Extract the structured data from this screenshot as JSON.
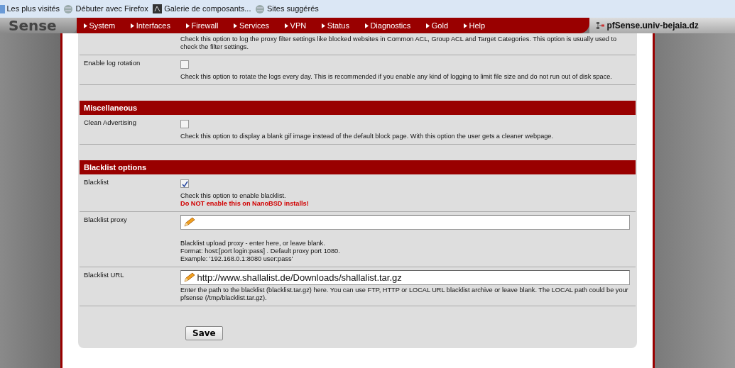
{
  "bookmarks": [
    {
      "label": "Les plus visités",
      "kind": "page"
    },
    {
      "label": "Débuter avec Firefox",
      "kind": "globe"
    },
    {
      "label": "Galerie de composants...",
      "kind": "gallery"
    },
    {
      "label": "Sites suggérés",
      "kind": "globe"
    }
  ],
  "logo": "Sense",
  "menu": [
    "System",
    "Interfaces",
    "Firewall",
    "Services",
    "VPN",
    "Status",
    "Diagnostics",
    "Gold",
    "Help"
  ],
  "hostname": "pfSense.univ-bejaia.dz",
  "sections": [
    {
      "rows": [
        {
          "kind": "note",
          "description": "Check this option to log the proxy filter settings like blocked websites in Common ACL, Group ACL and Target Categories. This option is usually used to check the filter settings."
        },
        {
          "kind": "checkbox",
          "label": "Enable log rotation",
          "checked": false,
          "description": "Check this option to rotate the logs every day. This is recommended if you enable any kind of logging to limit file size and do not run out of disk space."
        }
      ]
    },
    {
      "title": "Miscellaneous",
      "rows": [
        {
          "kind": "checkbox",
          "label": "Clean Advertising",
          "checked": false,
          "description": "Check this option to display a blank gif image instead of the default block page. With this option the user gets a cleaner webpage."
        }
      ]
    },
    {
      "title": "Blacklist options",
      "rows": [
        {
          "kind": "checkbox",
          "label": "Blacklist",
          "checked": true,
          "description": "Check this option to enable blacklist.",
          "warning": "Do NOT enable this on NanoBSD installs!"
        },
        {
          "kind": "text",
          "label": "Blacklist proxy",
          "value": "",
          "description_lines": [
            "Blacklist upload proxy - enter here, or leave blank.",
            "Format: host:[port login:pass] . Default proxy port 1080.",
            "Example: '192.168.0.1:8080 user:pass'"
          ]
        },
        {
          "kind": "text",
          "label": "Blacklist URL",
          "value": "http://www.shallalist.de/Downloads/shallalist.tar.gz",
          "description": "Enter the path to the blacklist (blacklist.tar.gz) here. You can use FTP, HTTP or LOCAL URL blacklist archive or leave blank. The LOCAL path could be your pfsense (/tmp/blacklist.tar.gz)."
        }
      ]
    }
  ],
  "save_button": "Save"
}
